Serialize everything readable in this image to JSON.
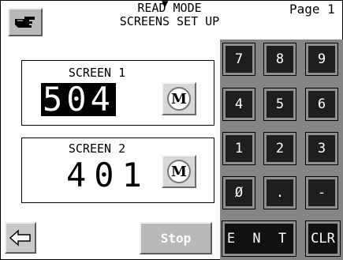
{
  "header": {
    "title_line1": "READ MODE",
    "title_line2": "SCREENS SET UP",
    "page_label": "Page 1"
  },
  "icons": {
    "top_indicator": "down-triangle-icon",
    "hand_button": "pointing-hand-icon",
    "back_button": "left-arrow-icon",
    "m_button": "m-circle-icon"
  },
  "screen1": {
    "label": "SCREEN 1",
    "value": "504",
    "m_label": "M"
  },
  "screen2": {
    "label": "SCREEN 2",
    "value": "401",
    "m_label": "M"
  },
  "keypad": {
    "keys": [
      "7",
      "8",
      "9",
      "4",
      "5",
      "6",
      "1",
      "2",
      "3",
      "Ø",
      ".",
      "-"
    ],
    "enter_label": "E N T",
    "clear_label": "CLR"
  },
  "stop_label": "Stop",
  "colors": {
    "keypad_background": "#858585",
    "key_face": "#1e1e1e",
    "button_gray": "#b9b9b9"
  }
}
